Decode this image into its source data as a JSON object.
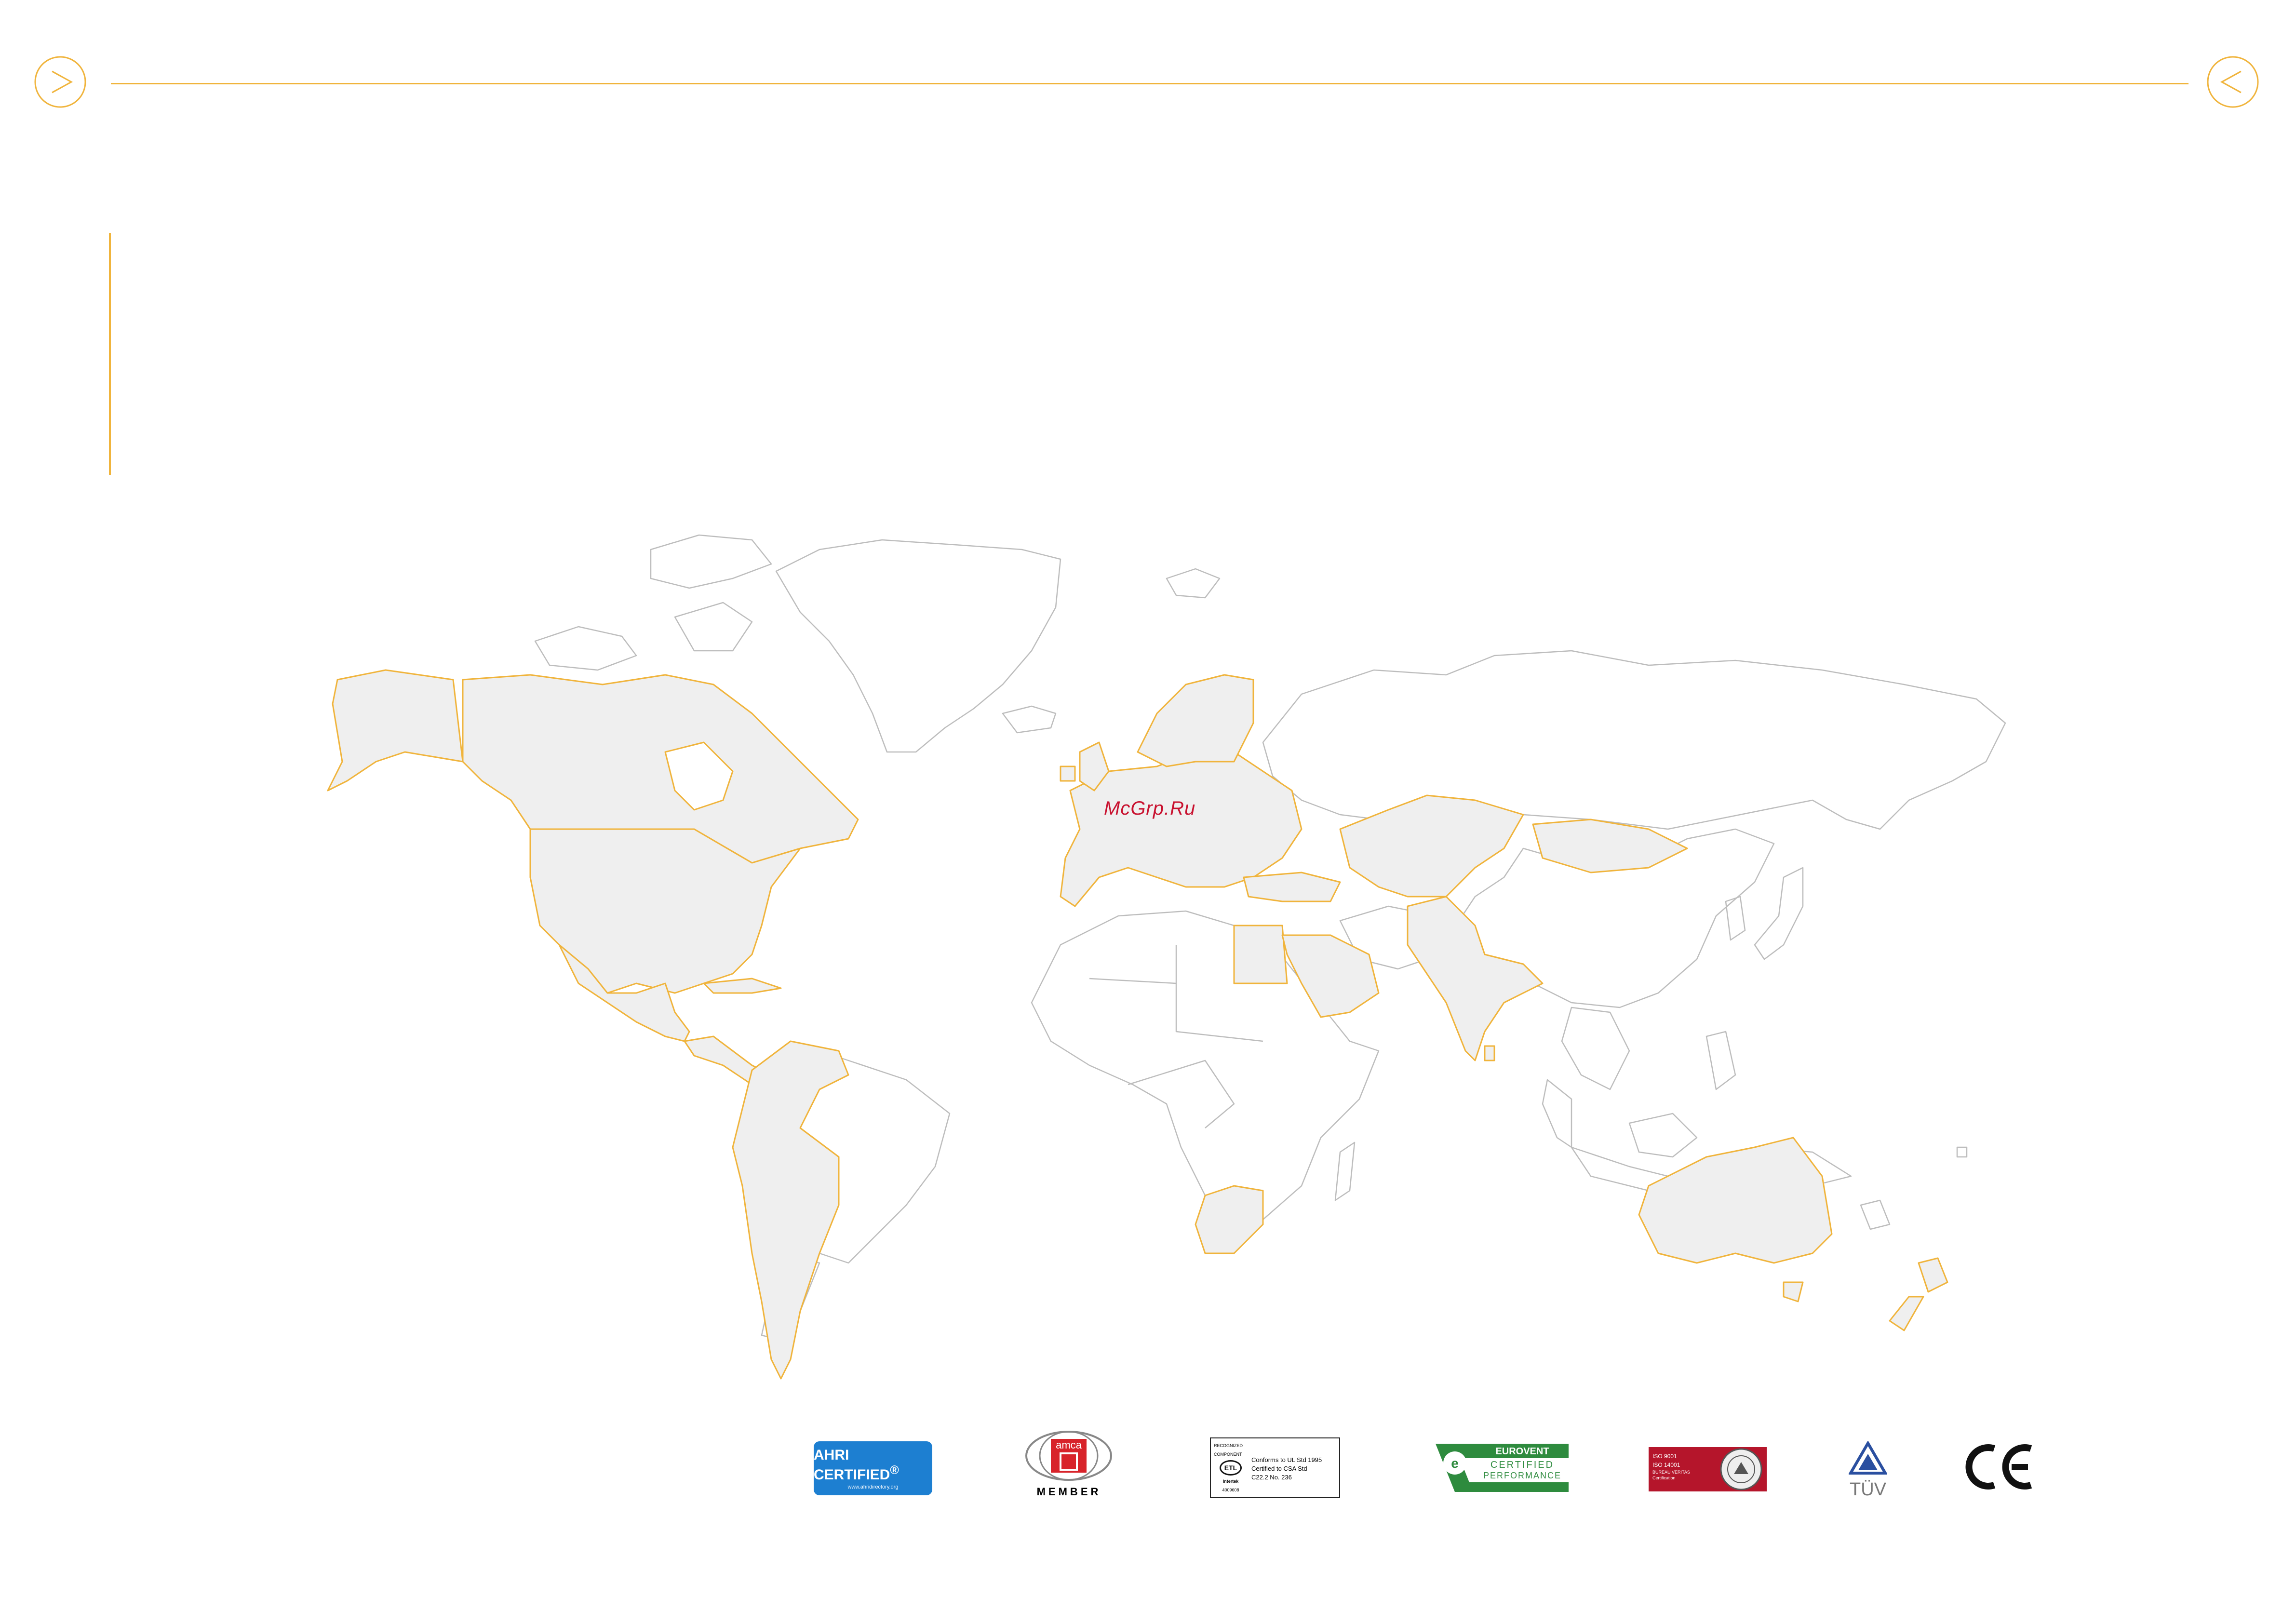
{
  "nav": {
    "prev_icon": "chevron-right-in-circle-icon",
    "next_icon": "chevron-left-in-circle-icon"
  },
  "colors": {
    "accent": "#F0B43C",
    "highlighted_country_fill": "#EFEFEF",
    "highlighted_country_border": "#F0B43C",
    "other_country_border": "#BDBDBD",
    "watermark": "#C8102E"
  },
  "map": {
    "type": "world map",
    "highlighted_regions": [
      "North America",
      "Central America",
      "Western South America",
      "Europe",
      "Middle East",
      "Central Asia",
      "India",
      "Mongolia",
      "Egypt",
      "Saudi Arabia",
      "South Africa",
      "Australia",
      "New Zealand"
    ],
    "watermark": "McGrp.Ru"
  },
  "certifications": {
    "ahri": {
      "main": "AHRI CERTIFIED",
      "reg": "®",
      "url": "www.ahridirectory.org",
      "color": "#1D7FD1"
    },
    "amca": {
      "brand": "amca",
      "member": "MEMBER",
      "color": "#D8232A"
    },
    "etl": {
      "recognized": "RECOGNIZED COMPONENT",
      "mark": "ETL",
      "brand": "Intertek",
      "number": "4009608",
      "line1": "Conforms to UL Std 1995",
      "line2": "Certified to CSA Std",
      "line3": "C22.2 No. 236"
    },
    "eurovent": {
      "line1": "EUROVENT",
      "line2": "CERTIFIED",
      "line3": "PERFORMANCE",
      "color": "#2E8B3E"
    },
    "iso": {
      "line1": "ISO 9001",
      "line2": "ISO 14001",
      "line3": "BUREAU VERITAS",
      "line4": "Certification",
      "color": "#B5152B"
    },
    "tuv": {
      "text": "TÜV",
      "color": "#2A4FA0"
    },
    "ce": {
      "text": "CE"
    }
  }
}
